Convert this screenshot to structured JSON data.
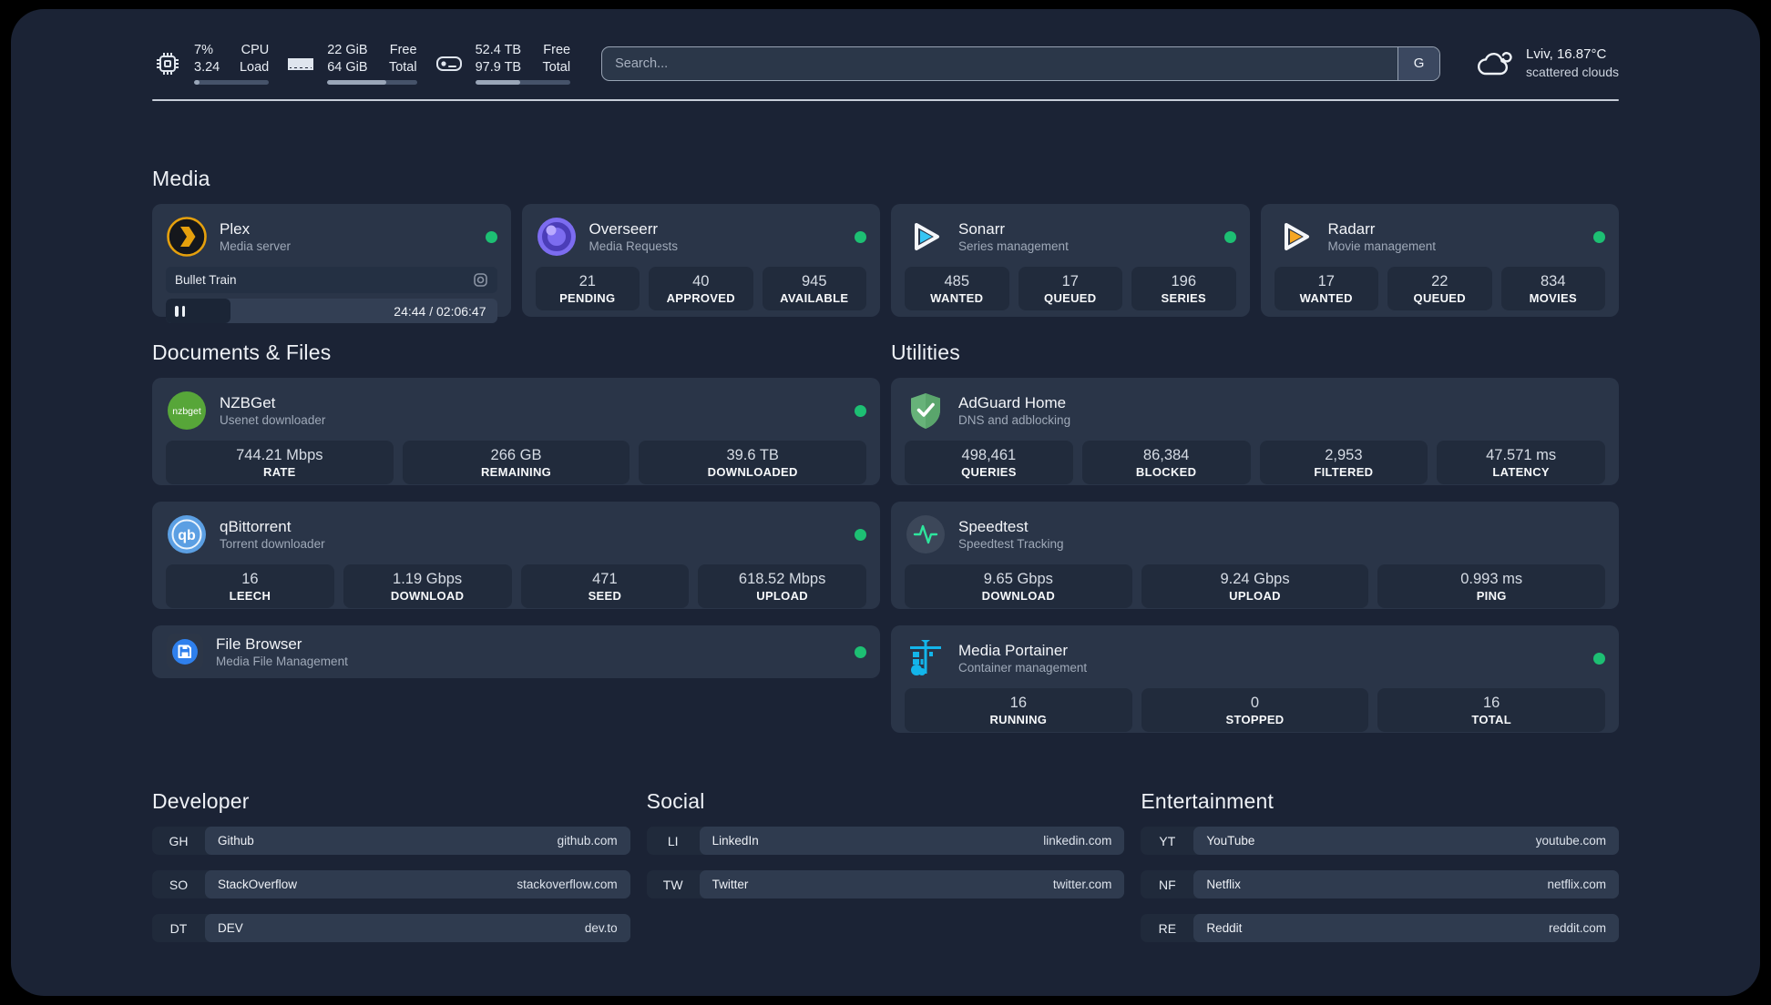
{
  "topbar": {
    "system": [
      {
        "id": "cpu",
        "icon": "cpu-icon",
        "value_top": "7%",
        "value_bottom": "3.24",
        "label_top": "CPU",
        "label_bottom": "Load",
        "progress_pct": 7
      },
      {
        "id": "memory",
        "icon": "ram-icon",
        "value_top": "22 GiB",
        "value_bottom": "64 GiB",
        "label_top": "Free",
        "label_bottom": "Total",
        "progress_pct": 66
      },
      {
        "id": "storage",
        "icon": "disk-icon",
        "value_top": "52.4 TB",
        "value_bottom": "97.9 TB",
        "label_top": "Free",
        "label_bottom": "Total",
        "progress_pct": 47
      }
    ],
    "search": {
      "placeholder": "Search...",
      "engine_button": "G"
    },
    "weather": {
      "location": "Lviv, 16.87°C",
      "condition": "scattered clouds"
    }
  },
  "media": {
    "title": "Media",
    "plex": {
      "name": "Plex",
      "description": "Media server",
      "online": true,
      "now_playing": {
        "title": "Bullet Train",
        "state": "paused",
        "time": "24:44 / 02:06:47",
        "progress_pct": 19.5
      }
    },
    "overseerr": {
      "name": "Overseerr",
      "description": "Media Requests",
      "online": true,
      "stats": [
        {
          "value": "21",
          "label": "PENDING"
        },
        {
          "value": "40",
          "label": "APPROVED"
        },
        {
          "value": "945",
          "label": "AVAILABLE"
        }
      ]
    },
    "sonarr": {
      "name": "Sonarr",
      "description": "Series management",
      "online": true,
      "stats": [
        {
          "value": "485",
          "label": "WANTED"
        },
        {
          "value": "17",
          "label": "QUEUED"
        },
        {
          "value": "196",
          "label": "SERIES"
        }
      ]
    },
    "radarr": {
      "name": "Radarr",
      "description": "Movie management",
      "online": true,
      "stats": [
        {
          "value": "17",
          "label": "WANTED"
        },
        {
          "value": "22",
          "label": "QUEUED"
        },
        {
          "value": "834",
          "label": "MOVIES"
        }
      ]
    }
  },
  "documents": {
    "title": "Documents & Files",
    "nzbget": {
      "name": "NZBGet",
      "description": "Usenet downloader",
      "online": true,
      "stats": [
        {
          "value": "744.21 Mbps",
          "label": "RATE"
        },
        {
          "value": "266 GB",
          "label": "REMAINING"
        },
        {
          "value": "39.6 TB",
          "label": "DOWNLOADED"
        }
      ]
    },
    "qbittorrent": {
      "name": "qBittorrent",
      "description": "Torrent downloader",
      "online": true,
      "stats": [
        {
          "value": "16",
          "label": "LEECH"
        },
        {
          "value": "1.19 Gbps",
          "label": "DOWNLOAD"
        },
        {
          "value": "471",
          "label": "SEED"
        },
        {
          "value": "618.52 Mbps",
          "label": "UPLOAD"
        }
      ]
    },
    "filebrowser": {
      "name": "File Browser",
      "description": "Media File Management",
      "online": true
    }
  },
  "utilities": {
    "title": "Utilities",
    "adguard": {
      "name": "AdGuard Home",
      "description": "DNS and adblocking",
      "stats": [
        {
          "value": "498,461",
          "label": "QUERIES"
        },
        {
          "value": "86,384",
          "label": "BLOCKED"
        },
        {
          "value": "2,953",
          "label": "FILTERED"
        },
        {
          "value": "47.571 ms",
          "label": "LATENCY"
        }
      ]
    },
    "speedtest": {
      "name": "Speedtest",
      "description": "Speedtest Tracking",
      "stats": [
        {
          "value": "9.65 Gbps",
          "label": "DOWNLOAD"
        },
        {
          "value": "9.24 Gbps",
          "label": "UPLOAD"
        },
        {
          "value": "0.993 ms",
          "label": "PING"
        }
      ]
    },
    "portainer": {
      "name": "Media Portainer",
      "description": "Container management",
      "online": true,
      "stats": [
        {
          "value": "16",
          "label": "RUNNING"
        },
        {
          "value": "0",
          "label": "STOPPED"
        },
        {
          "value": "16",
          "label": "TOTAL"
        }
      ]
    }
  },
  "bookmarks": {
    "developer": {
      "title": "Developer",
      "links": [
        {
          "tag": "GH",
          "name": "Github",
          "url": "github.com"
        },
        {
          "tag": "SO",
          "name": "StackOverflow",
          "url": "stackoverflow.com"
        },
        {
          "tag": "DT",
          "name": "DEV",
          "url": "dev.to"
        }
      ]
    },
    "social": {
      "title": "Social",
      "links": [
        {
          "tag": "LI",
          "name": "LinkedIn",
          "url": "linkedin.com"
        },
        {
          "tag": "TW",
          "name": "Twitter",
          "url": "twitter.com"
        }
      ]
    },
    "entertainment": {
      "title": "Entertainment",
      "links": [
        {
          "tag": "YT",
          "name": "YouTube",
          "url": "youtube.com"
        },
        {
          "tag": "NF",
          "name": "Netflix",
          "url": "netflix.com"
        },
        {
          "tag": "RE",
          "name": "Reddit",
          "url": "reddit.com"
        }
      ]
    }
  },
  "colors": {
    "online_dot": "#1dbf73",
    "plex_accent": "#e5a00d",
    "sonarr_accent": "#35c5f4",
    "radarr_accent": "#f5a623",
    "portainer_accent": "#13b5ea",
    "adguard_accent": "#67b279"
  }
}
